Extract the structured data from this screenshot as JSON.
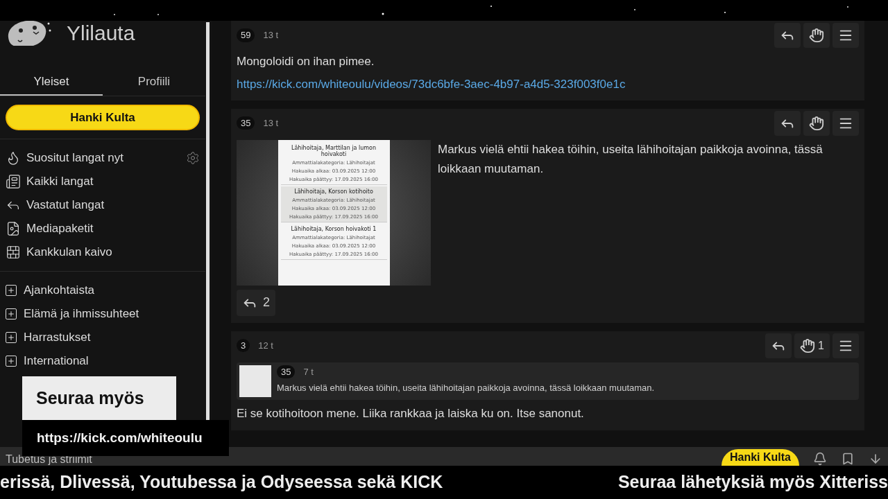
{
  "sidebar": {
    "title": "Ylilauta",
    "tabs": [
      {
        "label": "Yleiset",
        "selected": true
      },
      {
        "label": "Profiili",
        "selected": false
      }
    ],
    "gold_button": "Hanki Kulta",
    "nav_items": [
      {
        "label": "Suositut langat nyt",
        "has_settings": true
      },
      {
        "label": "Kaikki langat",
        "has_settings": false
      },
      {
        "label": "Vastatut langat",
        "has_settings": false
      },
      {
        "label": "Mediapaketit",
        "has_settings": false
      },
      {
        "label": "Kankkulan kaivo",
        "has_settings": false
      }
    ],
    "categories": [
      {
        "label": "Ajankohtaista"
      },
      {
        "label": "Elämä ja ihmissuhteet"
      },
      {
        "label": "Harrastukset"
      },
      {
        "label": "International"
      }
    ],
    "footer_item": "Tubetus ja striimit"
  },
  "overlay": {
    "heading": "Seuraa myös",
    "url": "https://kick.com/whiteoulu"
  },
  "posts": [
    {
      "score": "59",
      "time": "13 t",
      "text": "Mongoloidi on ihan pimee.",
      "link": "https://kick.com/whiteoulu/videos/73dc6bfe-3aec-4b97-a4d5-323f003f0e1c"
    },
    {
      "score": "35",
      "time": "13 t",
      "text": "Markus vielä ehtii hakea töihin, useita lähihoitajan paikkoja avoinna, tässä loikkaan muutaman.",
      "image": [
        {
          "title": "Lähihoitaja, Marttilan ja lumon hoivakoti",
          "category": "Ammattialakategoria: Lähihoitajat",
          "start": "Hakuaika alkaa: 03.09.2025 12:00",
          "end": "Hakuaika päättyy: 17.09.2025 16:00",
          "highlighted": false
        },
        {
          "title": "Lähihoitaja, Korson kotihoito",
          "category": "Ammattialakategoria: Lähihoitajat",
          "start": "Hakuaika alkaa: 03.09.2025 12:00",
          "end": "Hakuaika päättyy: 17.09.2025 16:00",
          "highlighted": true
        },
        {
          "title": "Lähihoitaja, Korson hoivakoti 1",
          "category": "Ammattialakategoria: Lähihoitajat",
          "start": "Hakuaika alkaa: 03.09.2025 12:00",
          "end": "Hakuaika päättyy: 17.09.2025 16:00",
          "highlighted": false
        }
      ],
      "replies": "2"
    },
    {
      "score": "3",
      "time": "12 t",
      "likes": "1",
      "quote": {
        "score": "35",
        "time": "7 t",
        "text": "Markus vielä ehtii hakea töihin, useita lähihoitajan paikkoja avoinna, tässä loikkaan muutaman."
      },
      "text": "Ei se kotihoitoon mene. Liika rankkaa ja laiska ku on. Itse sanonut."
    }
  ],
  "bottom_bar": {
    "gold_button": "Hanki Kulta"
  },
  "ticker": [
    "erissä, Dlivessä, Youtubessa ja Odyseessa sekä KICK",
    "Seuraa lähetyksiä myös Xitteriss"
  ]
}
